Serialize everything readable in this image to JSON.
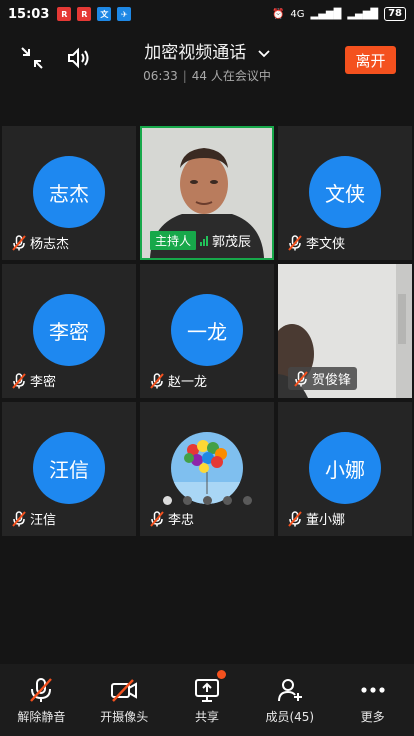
{
  "status_bar": {
    "time": "15:03",
    "network": "4G",
    "battery": "78"
  },
  "header": {
    "title": "加密视频通话",
    "duration": "06:33",
    "participants_text": "44 人在会议中",
    "leave_label": "离开"
  },
  "tiles": [
    {
      "avatar_text": "志杰",
      "name": "杨志杰",
      "type": "avatar",
      "muted": true
    },
    {
      "name": "郭茂辰",
      "type": "video",
      "host_label": "主持人",
      "active": true
    },
    {
      "avatar_text": "文侠",
      "name": "李文侠",
      "type": "avatar",
      "muted": true
    },
    {
      "avatar_text": "李密",
      "name": "李密",
      "type": "avatar",
      "muted": true
    },
    {
      "avatar_text": "一龙",
      "name": "赵一龙",
      "type": "avatar",
      "muted": true
    },
    {
      "name": "贺俊锋",
      "type": "video",
      "muted": true
    },
    {
      "avatar_text": "汪信",
      "name": "汪信",
      "type": "avatar",
      "muted": true
    },
    {
      "name": "李忠",
      "type": "image-avatar",
      "muted": true
    },
    {
      "avatar_text": "小娜",
      "name": "董小娜",
      "type": "avatar",
      "muted": true
    }
  ],
  "pagination": {
    "pages": 5,
    "current": 1
  },
  "toolbar": {
    "unmute": "解除静音",
    "camera": "开摄像头",
    "share": "共享",
    "members": "成员(45)",
    "more": "更多"
  },
  "colors": {
    "accent": "#1e88f0",
    "leave": "#f4511e",
    "host": "#17a84a"
  }
}
